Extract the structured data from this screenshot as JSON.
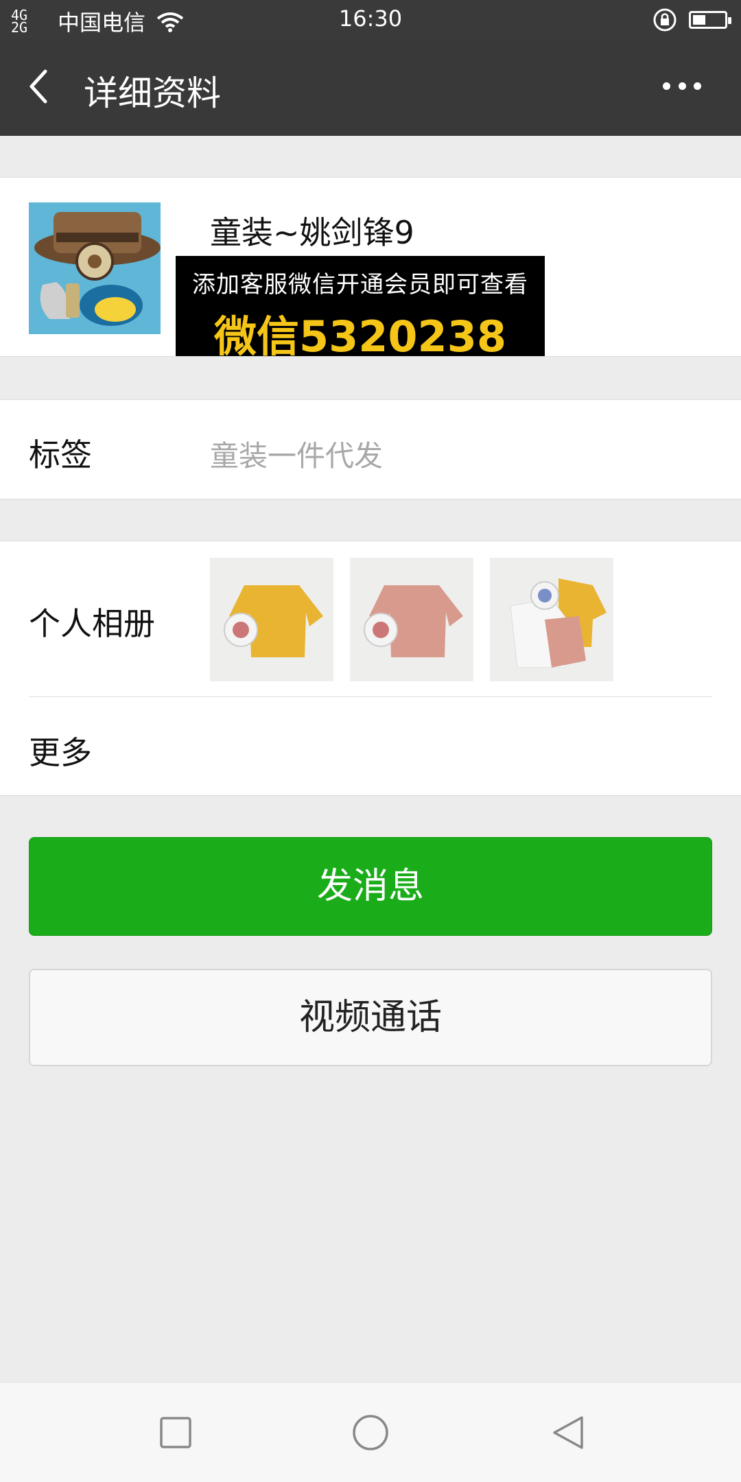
{
  "status_bar": {
    "signal": "4G 2G",
    "carrier": "中国电信",
    "time": "16:30"
  },
  "title_bar": {
    "title": "详细资料"
  },
  "profile": {
    "nickname": "童装~姚剑锋9",
    "promo_line1": "添加客服微信开通会员即可查看",
    "promo_line2": "微信5320238"
  },
  "tags_row": {
    "label": "标签",
    "value": "童装一件代发"
  },
  "album_row": {
    "label": "个人相册",
    "photos": [
      "yellow-sweater-photo",
      "pink-sweater-photo",
      "outfit-set-photo"
    ]
  },
  "more_row": {
    "label": "更多"
  },
  "buttons": {
    "send_message": "发消息",
    "video_call": "视频通话"
  },
  "colors": {
    "title_bar": "#393939",
    "accent_green": "#1aad19",
    "background": "#ececec"
  }
}
